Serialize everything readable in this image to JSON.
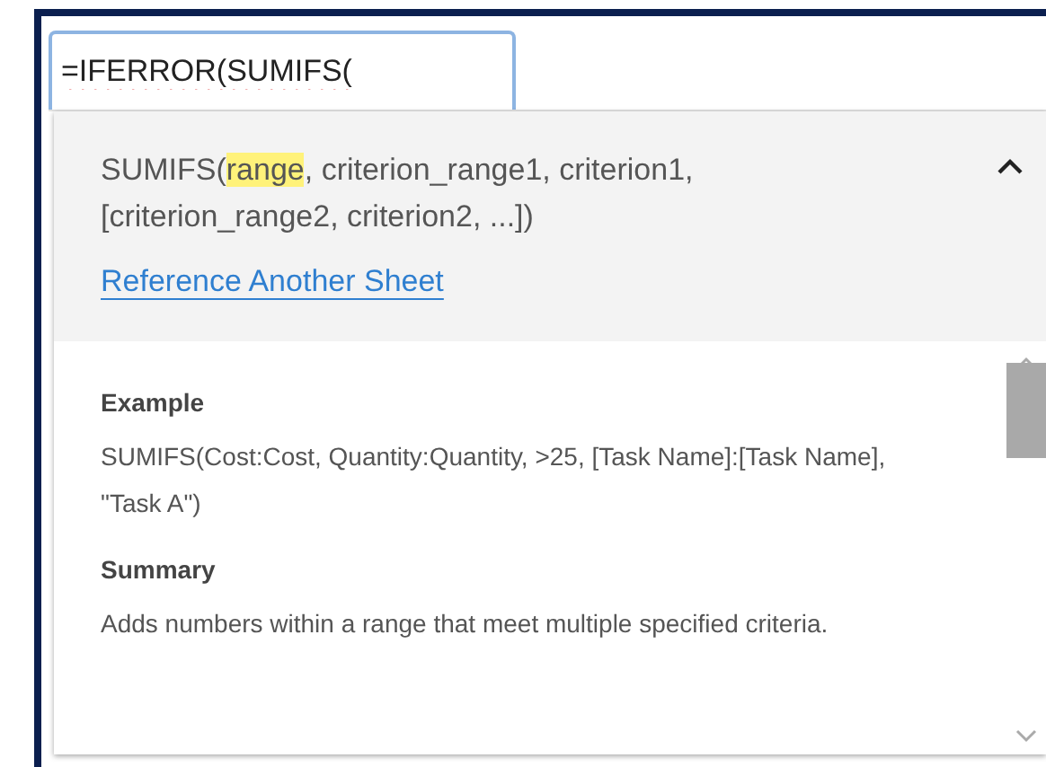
{
  "formula_input": {
    "value": "=IFERROR(SUMIFS("
  },
  "signature": {
    "before": "SUMIFS(",
    "highlight": "range",
    "after": ", criterion_range1, criterion1, [criterion_range2, criterion2, ...])",
    "expanded": true
  },
  "link": "Reference Another Sheet",
  "sections": [
    {
      "heading": "Example",
      "text": "SUMIFS(Cost:Cost, Quantity:Quantity, >25, [Task Name]:[Task Name], \"Task A\")"
    },
    {
      "heading": "Summary",
      "text": "Adds numbers within a range that meet multiple specified criteria."
    }
  ]
}
